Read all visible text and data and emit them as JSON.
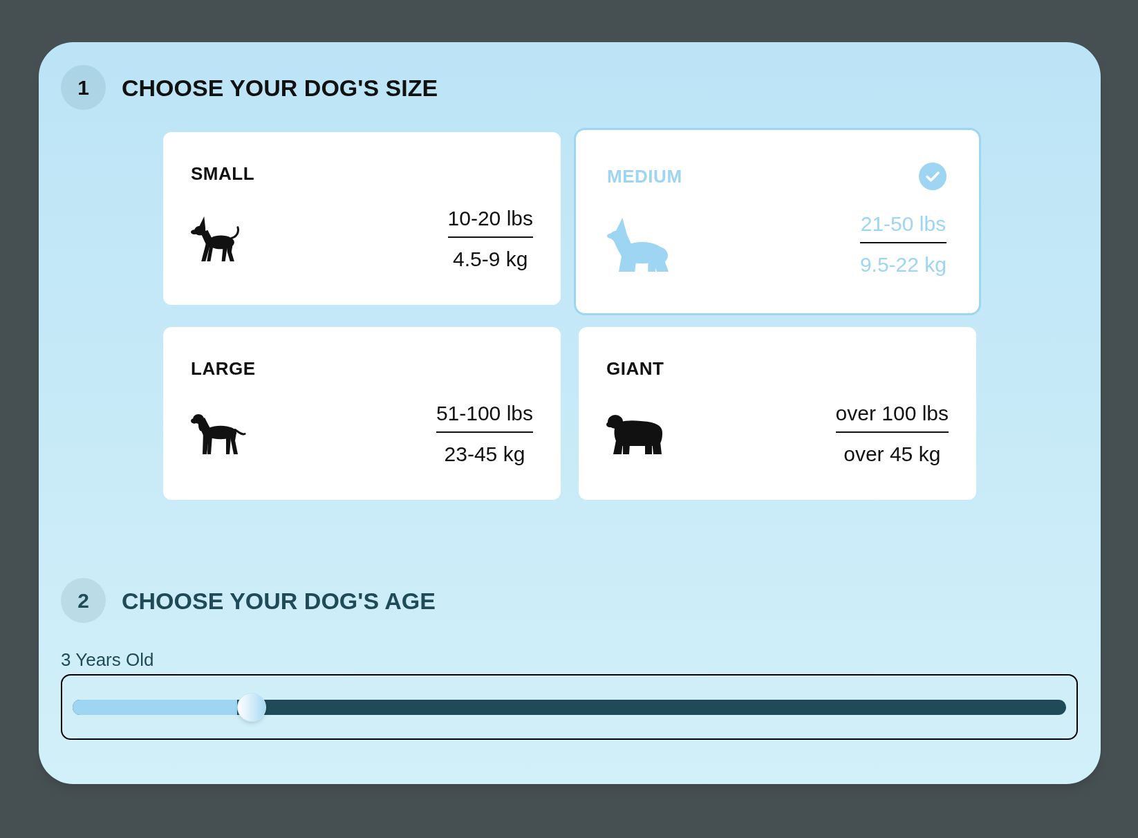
{
  "sections": [
    {
      "kind": "cards",
      "number": "1",
      "title": "CHOOSE YOUR DOG'S SIZE",
      "color": "#111111",
      "options": [
        {
          "label": "SMALL",
          "kind": "chihuahua",
          "weight_lbs": "10-20 lbs",
          "weight_kg": "4.5-9 kg",
          "selected": false
        },
        {
          "label": "MEDIUM",
          "kind": "corgi",
          "weight_lbs": "21-50 lbs",
          "weight_kg": "9.5-22 kg",
          "selected": true
        },
        {
          "label": "LARGE",
          "kind": "hound",
          "weight_lbs": "51-100 lbs",
          "weight_kg": "23-45 kg",
          "selected": false
        },
        {
          "label": "GIANT",
          "kind": "shaggy",
          "weight_lbs": "over 100 lbs",
          "weight_kg": "over 45 kg",
          "selected": false
        }
      ]
    },
    {
      "kind": "slider",
      "number": "2",
      "title": "CHOOSE YOUR DOG'S AGE",
      "color": "#1f4a58",
      "slider": {
        "label": "3 Years Old",
        "level": 0.18
      }
    }
  ]
}
